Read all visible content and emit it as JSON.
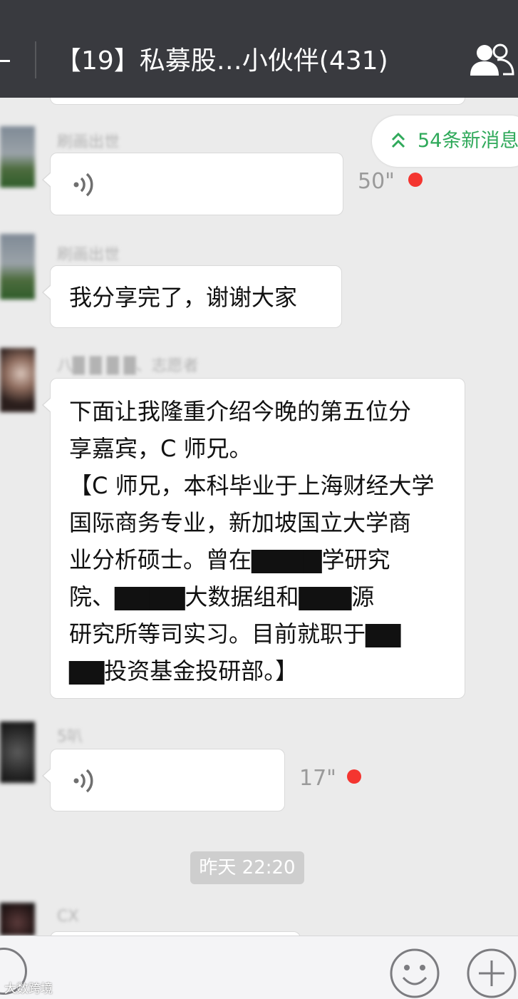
{
  "header": {
    "title": "【19】私募股…小伙伴(431)"
  },
  "new_messages": {
    "label": "54条新消息"
  },
  "messages": [
    {
      "type": "voice",
      "sender": "刷画出世",
      "duration": "50\"",
      "unread": true
    },
    {
      "type": "text",
      "sender": "刷画出世",
      "text": "我分享完了，谢谢大家"
    },
    {
      "type": "text",
      "sender": "八█ █ █ █、志愿者",
      "lines": [
        "下面让我隆重介绍今晚的第五位分",
        "享嘉宾，C 师兄。",
        "【C 师兄，本科毕业于上海财经大学",
        "国际商务专业，新加坡国立大学商",
        "业分析硕士。曾在▇▇▇▇学研究",
        "院、▇▇▇▇大数据组和▇▇▇源",
        "研究所等司实习。目前就职于▇▇",
        "▇▇投资基金投研部。】"
      ]
    },
    {
      "type": "voice",
      "sender": "5叭",
      "duration": "17\"",
      "unread": true
    },
    {
      "type": "time",
      "text": "昨天 22:20"
    },
    {
      "type": "text",
      "sender": "CX",
      "text": ""
    }
  ],
  "input_bar": {
    "voice_icon": "voice-toggle-icon",
    "emoji_icon": "emoji-icon",
    "plus_icon": "plus-icon"
  },
  "watermark": "大数跨境",
  "colors": {
    "titlebar": "#393a3f",
    "background": "#ebebeb",
    "unread_dot": "#f43530",
    "new_msg_green": "#2fa95a"
  }
}
